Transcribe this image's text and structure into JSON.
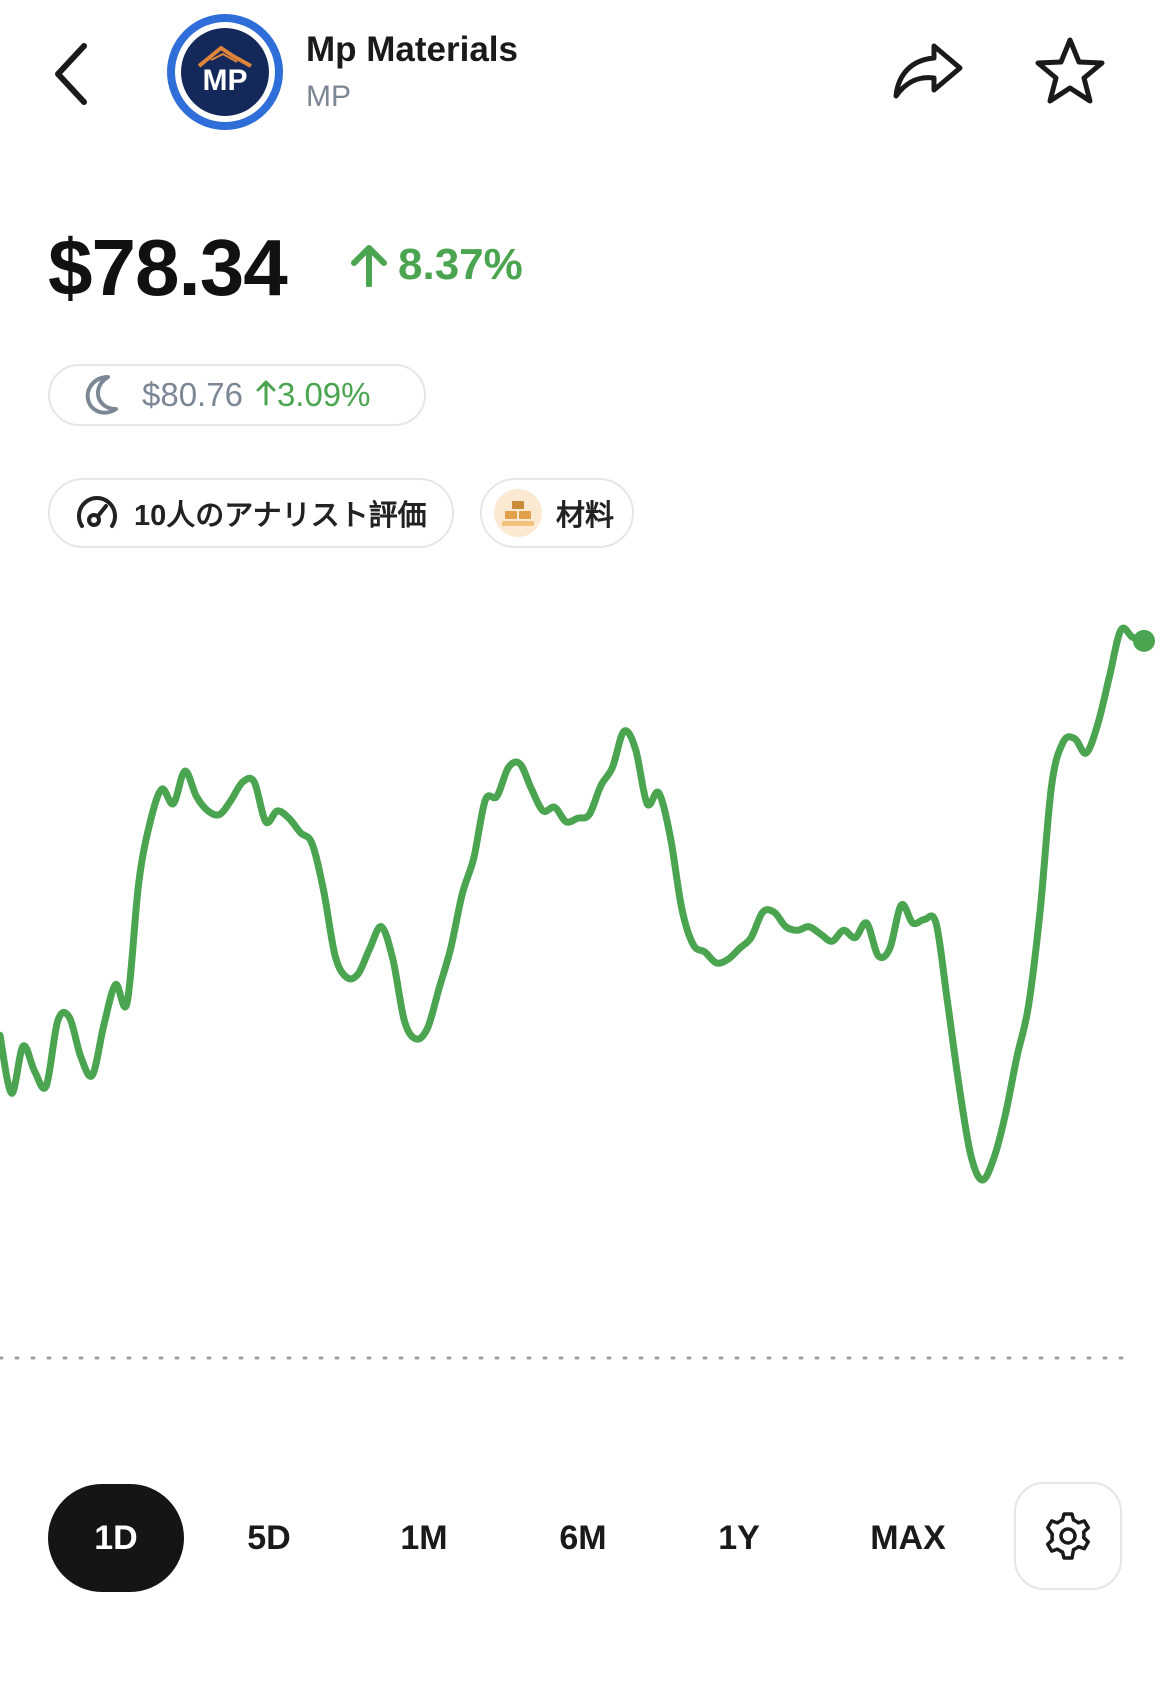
{
  "header": {
    "company_name": "Mp Materials",
    "ticker": "MP",
    "logo_text": "MP"
  },
  "quote": {
    "price": "$78.34",
    "change_pct": "8.37%",
    "change_direction": "up"
  },
  "after_hours": {
    "price": "$80.76",
    "change_pct": "3.09%",
    "icon": "moon-icon"
  },
  "chips": {
    "analyst_label": "10人のアナリスト評価",
    "sector_label": "材料"
  },
  "colors": {
    "positive": "#4aa450",
    "text_primary": "#111111",
    "text_secondary": "#7b8794",
    "active_tab_bg": "#151515",
    "logo_ring": "#2f6ed8",
    "logo_core": "#14285a"
  },
  "chart_data": {
    "type": "line",
    "line_color": "#4aa450",
    "baseline": "dotted",
    "values": [
      0.96,
      0.8,
      0.93,
      0.86,
      0.82,
      1.0,
      1.01,
      0.9,
      0.85,
      0.99,
      1.1,
      1.05,
      1.38,
      1.55,
      1.64,
      1.6,
      1.69,
      1.62,
      1.58,
      1.57,
      1.61,
      1.66,
      1.66,
      1.55,
      1.58,
      1.56,
      1.52,
      1.49,
      1.36,
      1.18,
      1.12,
      1.13,
      1.2,
      1.26,
      1.17,
      1.0,
      0.95,
      0.98,
      1.09,
      1.2,
      1.35,
      1.45,
      1.61,
      1.62,
      1.7,
      1.71,
      1.64,
      1.58,
      1.59,
      1.55,
      1.56,
      1.57,
      1.65,
      1.7,
      1.8,
      1.75,
      1.6,
      1.63,
      1.51,
      1.31,
      1.21,
      1.19,
      1.16,
      1.17,
      1.2,
      1.23,
      1.3,
      1.3,
      1.26,
      1.25,
      1.26,
      1.24,
      1.22,
      1.25,
      1.23,
      1.27,
      1.18,
      1.2,
      1.32,
      1.27,
      1.28,
      1.27,
      1.05,
      0.82,
      0.63,
      0.56,
      0.62,
      0.74,
      0.9,
      1.04,
      1.3,
      1.65,
      1.77,
      1.78,
      1.74,
      1.82,
      1.95,
      2.08,
      2.06,
      2.05
    ]
  },
  "ranges": {
    "tabs": [
      "1D",
      "5D",
      "1M",
      "6M",
      "1Y",
      "MAX"
    ],
    "active": "1D",
    "settings_icon": "gear-icon"
  }
}
